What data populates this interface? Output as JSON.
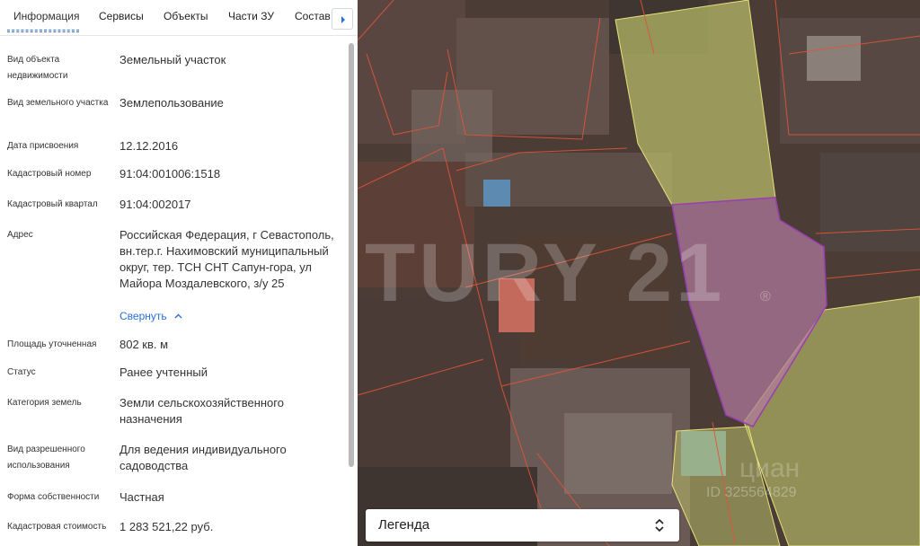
{
  "tabs": [
    {
      "label": "Информация",
      "active": true
    },
    {
      "label": "Сервисы"
    },
    {
      "label": "Объекты"
    },
    {
      "label": "Части ЗУ"
    },
    {
      "label": "Состав"
    }
  ],
  "fields": [
    {
      "label": "Вид объекта недвижимости",
      "value": "Земельный участок"
    },
    {
      "label": "Вид земельного участка",
      "value": "Землепользование"
    },
    {
      "label": "Дата присвоения",
      "value": "12.12.2016"
    },
    {
      "label": "Кадастровый номер",
      "value": "91:04:001006:1518"
    },
    {
      "label": "Кадастровый квартал",
      "value": "91:04:002017"
    },
    {
      "label": "Адрес",
      "value": "Российская Федерация, г Севастополь, вн.тер.г. Нахимовский муниципальный округ, тер. ТСН СНТ Сапун-гора, ул Майора Моздалевского, з/у 25"
    },
    {
      "label": "Площадь уточненная",
      "value": "802 кв. м"
    },
    {
      "label": "Статус",
      "value": "Ранее учтенный"
    },
    {
      "label": "Категория земель",
      "value": "Земли сельскохозяйственного назначения"
    },
    {
      "label": "Вид разрешенного использования",
      "value": "Для ведения индивидуального садоводства"
    },
    {
      "label": "Форма собственности",
      "value": "Частная"
    },
    {
      "label": "Кадастровая стоимость",
      "value": "1 283 521,22 руб."
    }
  ],
  "collapse_label": "Свернуть",
  "map": {
    "watermark": "TURY 21",
    "watermark_mark": "®",
    "watermark_brand": "циан",
    "watermark_id": "ID 325564829",
    "colors": {
      "parcel_border": "#e0553a",
      "selected_fill": "#b07a9c",
      "selected_border": "#9a3fb0",
      "neighbor_fill": "#b9bd6a",
      "neighbor_border": "#e7e27a"
    }
  },
  "legend": {
    "label": "Легенда"
  },
  "icons": {
    "tabs_next": "chevron-right-icon",
    "collapse": "chevron-up-icon",
    "legend_toggle": "sort-toggle-icon"
  }
}
